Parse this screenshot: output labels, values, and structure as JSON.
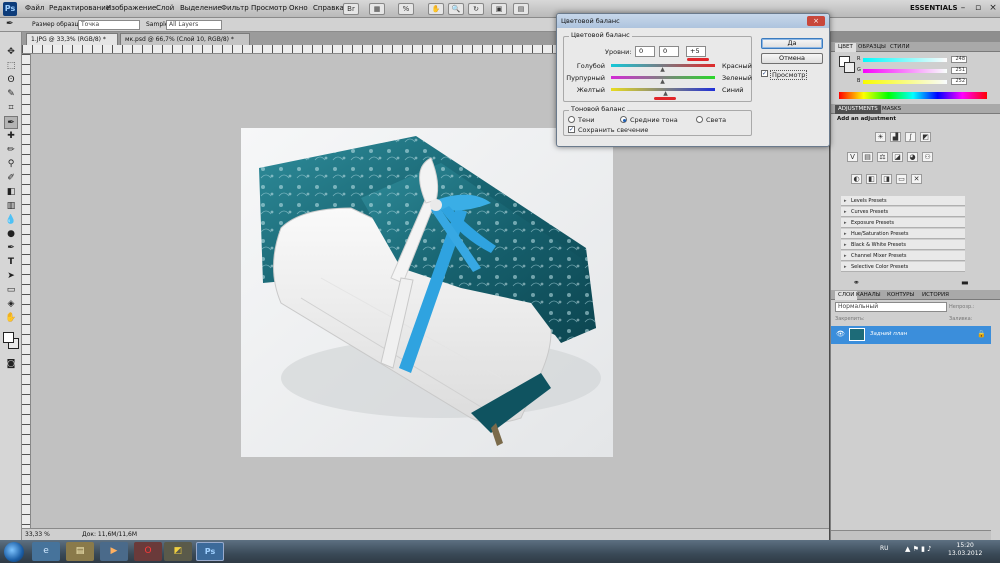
{
  "app": {
    "logo": "Ps",
    "workspace": "ESSENTIALS"
  },
  "menu": [
    "Файл",
    "Редактирование",
    "Изображение",
    "Слой",
    "Выделение",
    "Фильтр",
    "Просмотр",
    "Окно",
    "Справка"
  ],
  "options_bar": {
    "sample_size_label": "Размер образца:",
    "sample_size_value": "Точка",
    "sample_label": "Sample:",
    "sample_value": "All Layers"
  },
  "tabs": [
    {
      "label": "1.JPG @ 33,3% (RGB/8) *",
      "active": true
    },
    {
      "label": "мк.psd @ 66,7% (Слой 10, RGB/8) *",
      "active": false
    }
  ],
  "status": {
    "zoom": "33,33 %",
    "doc": "Док: 11,6M/11,6M"
  },
  "dialog": {
    "title": "Цветовой баланс",
    "color_balance_group": "Цветовой баланс",
    "levels_label": "Уровни:",
    "levels": [
      "0",
      "0",
      "+5"
    ],
    "sliders": [
      {
        "left": "Голубой",
        "right": "Красный",
        "value_pct": 50
      },
      {
        "left": "Пурпурный",
        "right": "Зеленый",
        "value_pct": 50
      },
      {
        "left": "Желтый",
        "right": "Синий",
        "value_pct": 52
      }
    ],
    "tone_group": "Тоновой баланс",
    "tones": [
      {
        "label": "Тени",
        "selected": false
      },
      {
        "label": "Средние тона",
        "selected": true
      },
      {
        "label": "Света",
        "selected": false
      }
    ],
    "preserve_luminosity": "Сохранить свечение",
    "ok": "Да",
    "cancel": "Отмена",
    "preview": "Просмотр"
  },
  "color_panel": {
    "tabs": [
      "ЦВЕТ",
      "ОБРАЗЦЫ",
      "СТИЛИ"
    ],
    "channels": [
      {
        "name": "R",
        "value": "248",
        "color": "#ff4040"
      },
      {
        "name": "G",
        "value": "251",
        "color": "#30d030"
      },
      {
        "name": "B",
        "value": "252",
        "color": "#3a6cff"
      }
    ]
  },
  "adjustments_panel": {
    "tabs": [
      "ADJUSTMENTS",
      "MASKS"
    ],
    "heading": "Add an adjustment",
    "presets": [
      "Levels Presets",
      "Curves Presets",
      "Exposure Presets",
      "Hue/Saturation Presets",
      "Black & White Presets",
      "Channel Mixer Presets",
      "Selective Color Presets"
    ]
  },
  "layers_panel": {
    "tabs": [
      "СЛОИ",
      "КАНАЛЫ",
      "КОНТУРЫ",
      "ИСТОРИЯ"
    ],
    "blend_mode": "Нормальный",
    "opacity_label": "Непрозр.:",
    "lock_label": "Закрепить:",
    "fill_label": "Заливка:",
    "layer_name": "Задний план"
  },
  "taskbar": {
    "lang": "RU",
    "time": "15:20",
    "date": "13.03.2012"
  }
}
